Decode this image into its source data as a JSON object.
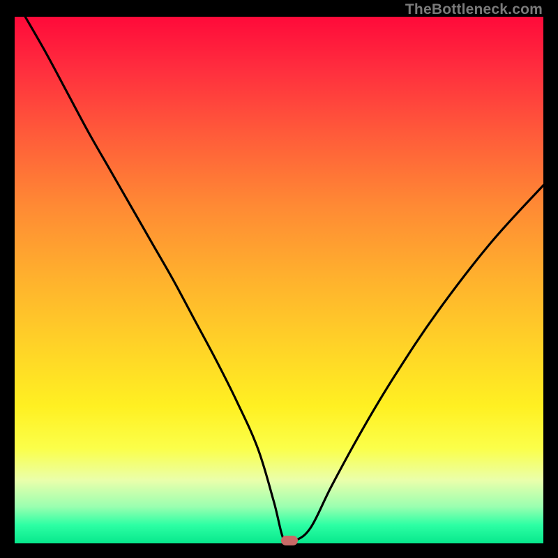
{
  "watermark": "TheBottleneck.com",
  "colors": {
    "curve_stroke": "#000000",
    "marker_fill": "#c96a67",
    "frame_bg": "#000000"
  },
  "chart_data": {
    "type": "line",
    "title": "",
    "xlabel": "",
    "ylabel": "",
    "xlim": [
      0,
      100
    ],
    "ylim": [
      0,
      100
    ],
    "series": [
      {
        "name": "bottleneck-curve",
        "x": [
          2,
          6,
          10,
          14,
          18,
          22,
          26,
          30,
          34,
          38,
          42,
          46,
          49,
          51,
          53,
          56,
          60,
          66,
          72,
          80,
          90,
          100
        ],
        "values": [
          100,
          93,
          85.5,
          78,
          71,
          64,
          57,
          50,
          42.5,
          35,
          27,
          18,
          8,
          0.5,
          0.5,
          3,
          11,
          22,
          32,
          44,
          57,
          68
        ]
      }
    ],
    "marker": {
      "x": 52,
      "y": 0.5
    },
    "gradient_bands": [
      "#ff0a3a",
      "#ff8a34",
      "#ffd427",
      "#fbff4a",
      "#2dffa4"
    ]
  }
}
